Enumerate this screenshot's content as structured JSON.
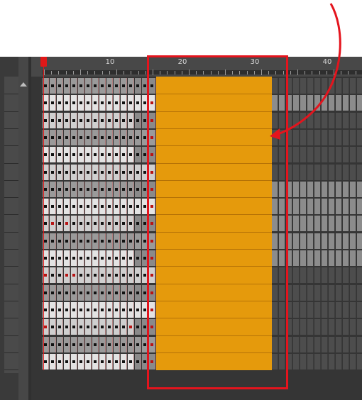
{
  "timeline": {
    "ruler_labels": [
      "10",
      "20",
      "30",
      "40"
    ],
    "ruler_start_frame": 1,
    "current_frame": 1,
    "selected_frames": [
      17,
      32
    ],
    "layer_count": 17,
    "scroll_icon": "scroll-up-arrow-icon"
  },
  "colors": {
    "selection_fill": "#e59a0c",
    "annotation": "#e4141d",
    "playhead": "#e01818",
    "panel": "#3a3a3a"
  },
  "annotation": {
    "type": "highlight-with-arrow",
    "arrow_icon": "curved-arrow-icon"
  }
}
